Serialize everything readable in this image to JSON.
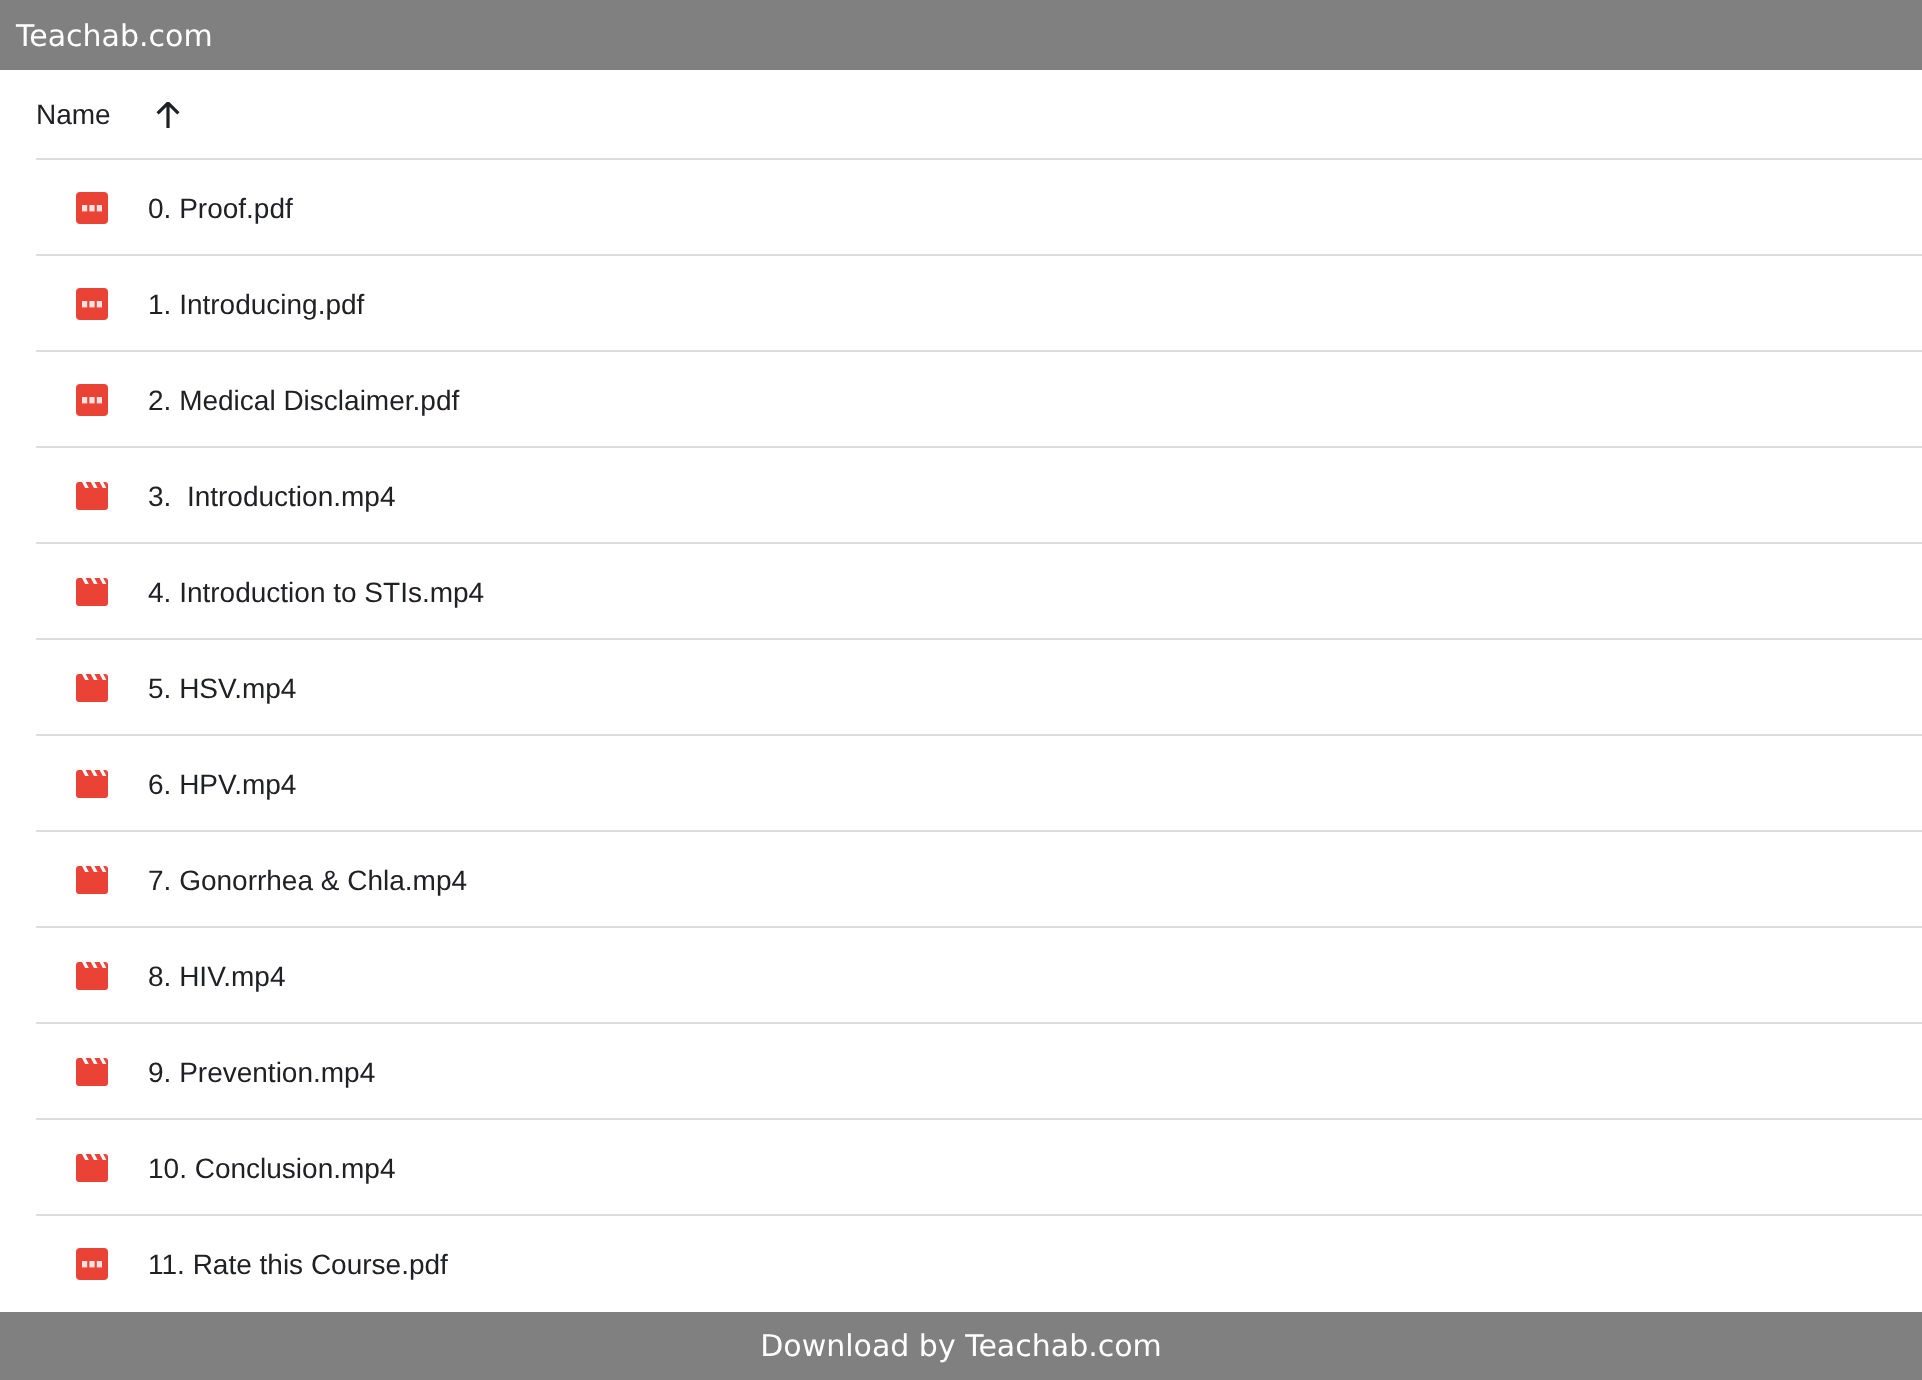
{
  "header": {
    "title": "Teachab.com"
  },
  "table": {
    "column": {
      "label": "Name",
      "sorted": true
    },
    "rows": [
      {
        "kind": "pdf",
        "name": "0. Proof.pdf"
      },
      {
        "kind": "pdf",
        "name": "1. Introducing.pdf"
      },
      {
        "kind": "pdf",
        "name": "2. Medical Disclaimer.pdf"
      },
      {
        "kind": "video",
        "name": "3.  Introduction.mp4"
      },
      {
        "kind": "video",
        "name": "4. Introduction to STIs.mp4"
      },
      {
        "kind": "video",
        "name": "5. HSV.mp4"
      },
      {
        "kind": "video",
        "name": "6. HPV.mp4"
      },
      {
        "kind": "video",
        "name": "7. Gonorrhea & Chla.mp4"
      },
      {
        "kind": "video",
        "name": "8. HIV.mp4"
      },
      {
        "kind": "video",
        "name": "9. Prevention.mp4"
      },
      {
        "kind": "video",
        "name": "10. Conclusion.mp4"
      },
      {
        "kind": "pdf",
        "name": "11. Rate this Course.pdf"
      }
    ]
  },
  "footer": {
    "text": "Download by Teachab.com"
  }
}
